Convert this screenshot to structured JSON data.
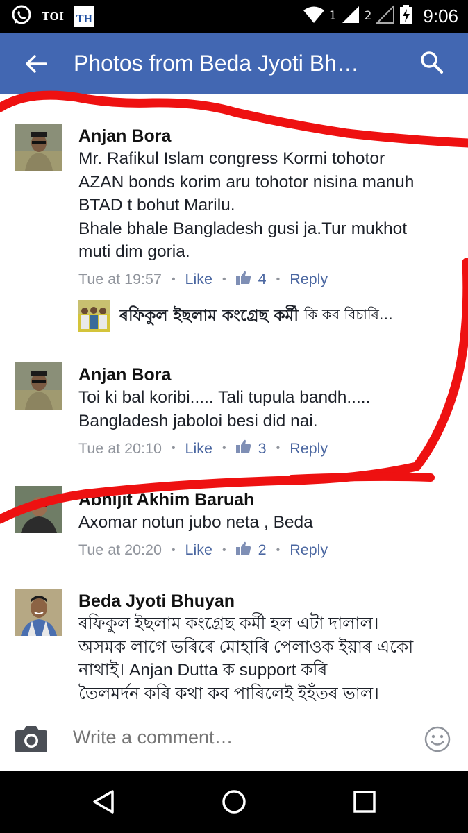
{
  "status_bar": {
    "toi_label": "TOI",
    "th_label": "TH",
    "sim1": "1",
    "sim2": "2",
    "time": "9:06"
  },
  "app_bar": {
    "title": "Photos from Beda Jyoti Bh…",
    "back_icon": "back-arrow-icon",
    "search_icon": "search-icon",
    "color": "#4267b2"
  },
  "comments": [
    {
      "author": "Anjan Bora",
      "text": "Mr. Rafikul Islam congress Kormi tohotor\nAZAN bonds korim aru tohotor nisina manuh\nBTAD t bohut Marilu.\nBhale bhale Bangladesh gusi ja.Tur mukhot\nmuti dim goria.",
      "time": "Tue at 19:57",
      "like_label": "Like",
      "likes": "4",
      "reply_label": "Reply"
    },
    {
      "author": "Anjan Bora",
      "text": "Toi ki bal koribi..... Tali tupula bandh.....\nBangladesh jaboloi besi did nai.",
      "time": "Tue at 20:10",
      "like_label": "Like",
      "likes": "3",
      "reply_label": "Reply"
    },
    {
      "author": "Abhijit Akhim Baruah",
      "text": "Axomar notun jubo neta , Beda",
      "time": "Tue at 20:20",
      "like_label": "Like",
      "likes": "2",
      "reply_label": "Reply"
    },
    {
      "author": "Beda Jyoti Bhuyan",
      "text": "ৰফিকুল ইছলাম কংগ্ৰেছ কৰ্মী  হল এটা দালাল।\nঅসমক লাগে ভৰিৰে মোহাৰি পেলাওক ইয়াৰ একো\nনাথাই।               Anjan Dutta ক support কৰি\nতৈলমৰ্দন কৰি কথা কব পাৰিলেই ইহঁতৰ ভাল।"
    }
  ],
  "reply_preview": {
    "author": "ৰফিকুল ইছলাম কংগ্ৰেছ কৰ্মী",
    "text": "কি কব বিচাৰি…"
  },
  "composer": {
    "placeholder": "Write a comment…",
    "camera_icon": "camera-icon",
    "emoji_icon": "emoji-icon"
  },
  "nav": {
    "back_icon": "nav-back-icon",
    "home_icon": "nav-home-icon",
    "recents_icon": "nav-recents-icon"
  },
  "colors": {
    "link": "#4b67a1",
    "meta": "#90949c",
    "scribble": "#ee1111"
  }
}
